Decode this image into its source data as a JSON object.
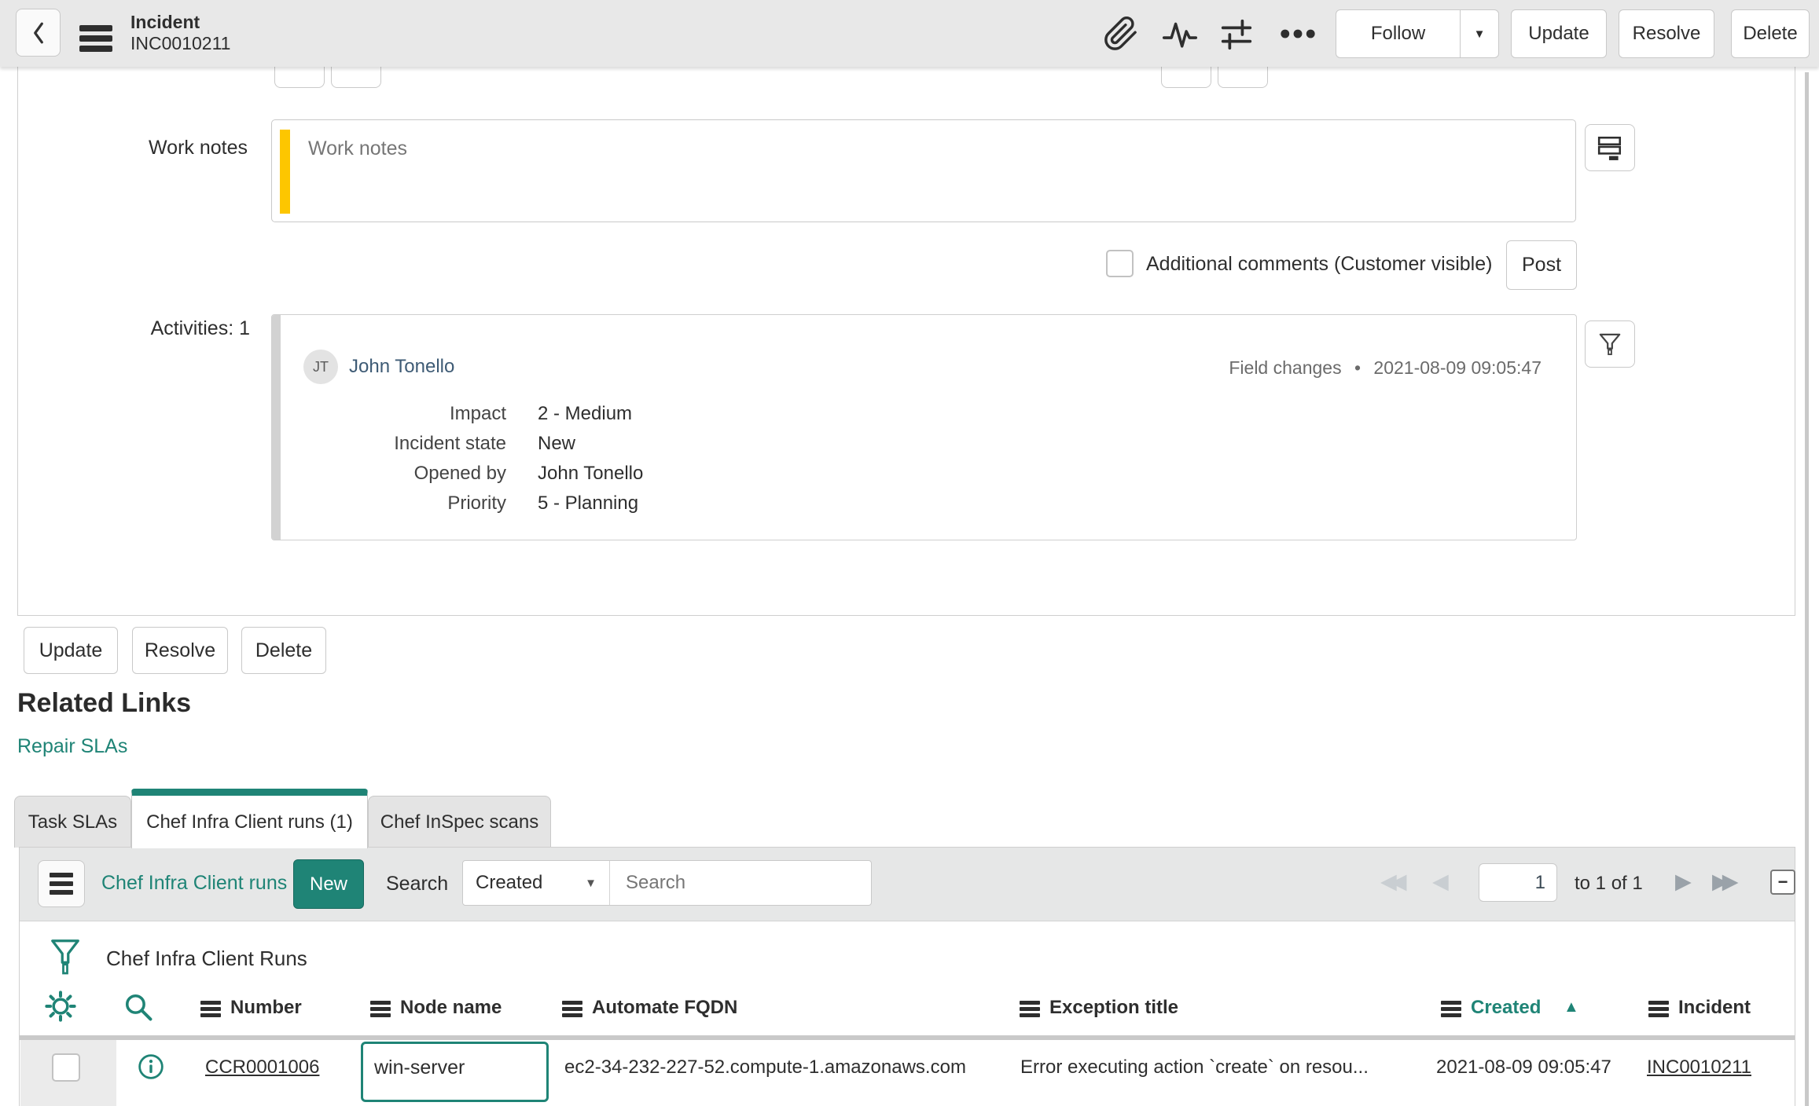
{
  "header": {
    "record_type": "Incident",
    "record_number": "INC0010211",
    "follow_label": "Follow",
    "update_label": "Update",
    "resolve_label": "Resolve",
    "delete_label": "Delete"
  },
  "form": {
    "work_notes_label": "Work notes",
    "work_notes_placeholder": "Work notes",
    "additional_comments_label": "Additional comments (Customer visible)",
    "post_label": "Post",
    "activities_label": "Activities: 1",
    "activity": {
      "avatar_initials": "JT",
      "author": "John Tonello",
      "meta_type": "Field changes",
      "timestamp": "2021-08-09 09:05:47",
      "fields": [
        {
          "label": "Impact",
          "value": "2 - Medium"
        },
        {
          "label": "Incident state",
          "value": "New"
        },
        {
          "label": "Opened by",
          "value": "John Tonello"
        },
        {
          "label": "Priority",
          "value": "5 - Planning"
        }
      ]
    }
  },
  "footer": {
    "update_label": "Update",
    "resolve_label": "Resolve",
    "delete_label": "Delete"
  },
  "related_links": {
    "title": "Related Links",
    "repair_link": "Repair SLAs"
  },
  "tabs": {
    "task_slas": "Task SLAs",
    "chef_infra": "Chef Infra Client runs (1)",
    "chef_inspec": "Chef InSpec scans"
  },
  "list": {
    "title_link": "Chef Infra Client runs",
    "new_button": "New",
    "search_label": "Search",
    "search_column_selected": "Created",
    "search_placeholder": "Search",
    "pagination": {
      "current_page": "1",
      "range_text": "to 1 of 1"
    },
    "table_title": "Chef Infra Client Runs",
    "columns": [
      "Number",
      "Node name",
      "Automate FQDN",
      "Exception title",
      "Created",
      "Incident"
    ],
    "sorted_column": "Created",
    "sort_direction": "ascending",
    "rows": [
      {
        "number": "CCR0001006",
        "node_name": "win-server",
        "automate_fqdn": "ec2-34-232-227-52.compute-1.amazonaws.com",
        "exception_title": "Error executing action `create` on resou...",
        "created": "2021-08-09 09:05:47",
        "incident": "INC0010211"
      }
    ]
  },
  "icons": {
    "dropdown_arrow": "▼",
    "sort_asc": "▲",
    "first_page": "◀◀",
    "prev_page": "◀",
    "next_page": "▶",
    "last_page": "▶▶",
    "collapse": "−",
    "dot": "•"
  },
  "colors": {
    "accent_teal": "#1f8476",
    "work_notes_yellow": "#fdc600",
    "header_gray": "#e8e8e8",
    "author_link": "#3e5b75"
  }
}
